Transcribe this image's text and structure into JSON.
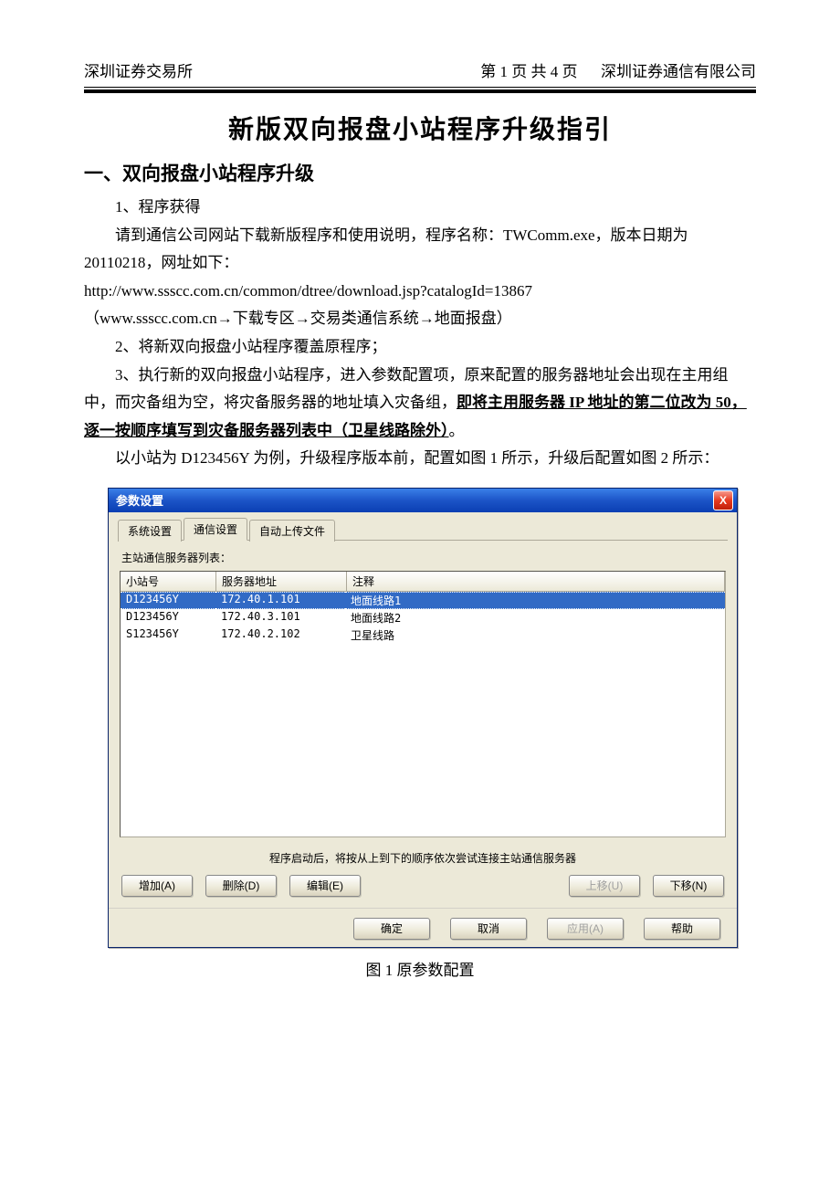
{
  "header": {
    "left": "深圳证券交易所",
    "center": "第 1 页 共 4 页",
    "right": "深圳证券通信有限公司"
  },
  "title": "新版双向报盘小站程序升级指引",
  "section1": {
    "heading": "一、双向报盘小站程序升级",
    "p1": "1、程序获得",
    "p2": "请到通信公司网站下载新版程序和使用说明，程序名称：TWComm.exe，版本日期为 20110218，网址如下：",
    "url": "http://www.ssscc.com.cn/common/dtree/download.jsp?catalogId=13867",
    "path": "（www.ssscc.com.cn→下载专区→交易类通信系统→地面报盘）",
    "p3": "2、将新双向报盘小站程序覆盖原程序；",
    "p4a": "3、执行新的双向报盘小站程序，进入参数配置项，原来配置的服务器地址会出现在主用组中，而灾备组为空，将灾备服务器的地址填入灾备组，",
    "p4b": "即将主用服务器 IP 地址的第二位改为 50，逐一按顺序填写到灾备服务器列表中（卫星线路除外）",
    "p4c": "。",
    "p5": "以小站为 D123456Y 为例，升级程序版本前，配置如图 1 所示，升级后配置如图 2 所示："
  },
  "dialog": {
    "title": "参数设置",
    "close": "X",
    "tabs": [
      "系统设置",
      "通信设置",
      "自动上传文件"
    ],
    "active_tab": 1,
    "section_label": "主站通信服务器列表：",
    "columns": [
      "小站号",
      "服务器地址",
      "注释"
    ],
    "rows": [
      {
        "station": "D123456Y",
        "addr": "172.40.1.101",
        "note": "地面线路1",
        "selected": true
      },
      {
        "station": "D123456Y",
        "addr": "172.40.3.101",
        "note": "地面线路2",
        "selected": false
      },
      {
        "station": "S123456Y",
        "addr": "172.40.2.102",
        "note": "卫星线路",
        "selected": false
      }
    ],
    "hint": "程序启动后，将按从上到下的顺序依次尝试连接主站通信服务器",
    "buttons": {
      "add": "增加(A)",
      "del": "删除(D)",
      "edit": "编辑(E)",
      "up": "上移(U)",
      "down": "下移(N)"
    },
    "footer": {
      "ok": "确定",
      "cancel": "取消",
      "apply": "应用(A)",
      "help": "帮助"
    }
  },
  "figcaption": "图 1  原参数配置"
}
